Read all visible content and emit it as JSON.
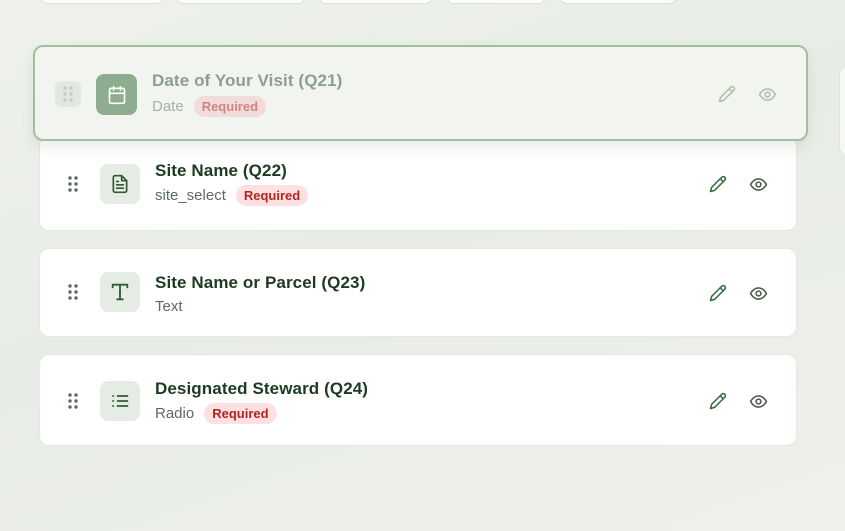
{
  "questions": [
    {
      "title": "Date of Your Visit (Q21)",
      "type": "Date",
      "badge": "Required",
      "icon": "calendar-icon",
      "state": "dragging"
    },
    {
      "title": "Site Name (Q22)",
      "type": "site_select",
      "badge": "Required",
      "icon": "document-icon"
    },
    {
      "title": "Site Name or Parcel (Q23)",
      "type": "Text",
      "badge": "",
      "icon": "text-type-icon"
    },
    {
      "title": "Designated Steward (Q24)",
      "type": "Radio",
      "badge": "Required",
      "icon": "list-icon"
    }
  ],
  "actions": {
    "edit_icon": "pencil-icon",
    "view_icon": "eye-icon",
    "drag_icon": "drag-handle-icon"
  },
  "colors": {
    "accent": "#2f6b3a",
    "badge_bg": "#fde0e0",
    "badge_text": "#b42323",
    "drag_border": "#9ebd9c"
  }
}
